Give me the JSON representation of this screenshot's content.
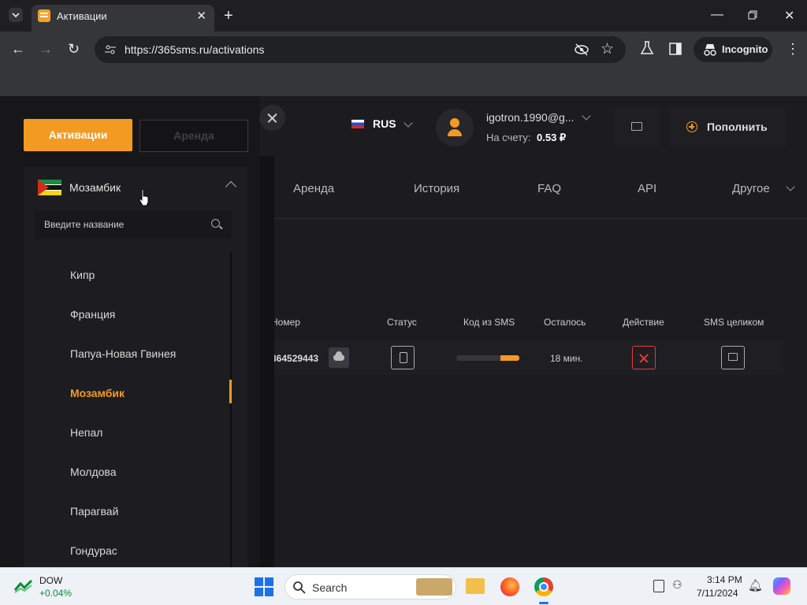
{
  "browser": {
    "tab_title": "Активации",
    "url": "https://365sms.ru/activations",
    "incognito_label": "Incognito"
  },
  "sidebar": {
    "activations_button": "Активации",
    "rent_button": "Аренда",
    "selected_country": "Мозамбик",
    "search_placeholder": "Введите название",
    "countries": [
      {
        "name": "Кипр"
      },
      {
        "name": "Франция"
      },
      {
        "name": "Папуа-Новая Гвинея"
      },
      {
        "name": "Мозамбик"
      },
      {
        "name": "Непал"
      },
      {
        "name": "Молдова"
      },
      {
        "name": "Парагвай"
      },
      {
        "name": "Гондурас"
      }
    ]
  },
  "header": {
    "language": "RUS",
    "email": "igotron.1990@g...",
    "balance_label": "На счету:",
    "balance_value": "0.53 ₽",
    "topup_label": "Пополнить"
  },
  "nav": {
    "rent": "Аренда",
    "history": "История",
    "faq": "FAQ",
    "api": "API",
    "other": "Другое"
  },
  "table": {
    "headers": {
      "number": "Номер",
      "status": "Статус",
      "sms_code": "Код из SMS",
      "remaining": "Осталось",
      "action": "Действие",
      "sms_full": "SMS целиком"
    },
    "rows": [
      {
        "number": "364529443",
        "remaining": "18 мин.",
        "progress_percent": 30
      }
    ]
  },
  "taskbar": {
    "stock_name": "DOW",
    "stock_change": "+0.04%",
    "search_label": "Search",
    "time": "3:14 PM",
    "date": "7/11/2024"
  },
  "colors": {
    "accent": "#f39a23",
    "danger": "#e03a3a",
    "stock_up": "#0a8a3a"
  }
}
